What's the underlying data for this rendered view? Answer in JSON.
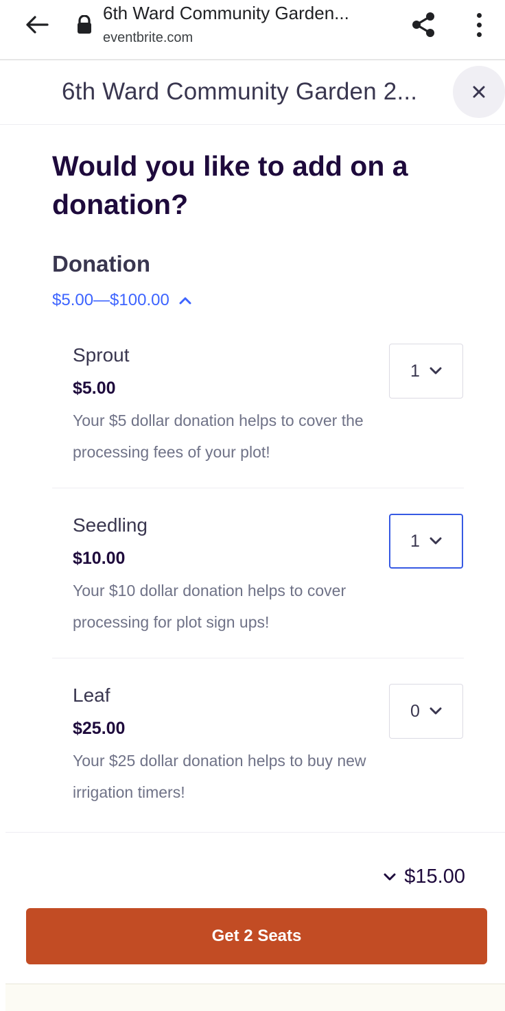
{
  "browser": {
    "page_title": "6th Ward Community Garden...",
    "domain": "eventbrite.com",
    "icons": [
      "back-arrow-icon",
      "lock-icon",
      "share-icon",
      "more-vert-icon"
    ]
  },
  "modal": {
    "title": "6th Ward Community Garden 2...",
    "close_icon": "close-icon"
  },
  "question": "Would you like to add on a donation?",
  "section": {
    "title": "Donation",
    "price_range": "$5.00—$100.00",
    "toggle_icon": "chevron-up-icon"
  },
  "tickets": [
    {
      "name": "Sprout",
      "price": "$5.00",
      "description": "Your $5 dollar donation helps to cover the processing fees of your plot!",
      "quantity": "1"
    },
    {
      "name": "Seedling",
      "price": "$10.00",
      "description": "Your $10 dollar donation helps to cover processing for plot sign ups!",
      "quantity": "1"
    },
    {
      "name": "Leaf",
      "price": "$25.00",
      "description": "Your $25 dollar donation helps to buy new irrigation timers!",
      "quantity": "0"
    }
  ],
  "footer": {
    "total": "$15.00",
    "checkout_label": "Get 2 Seats"
  },
  "colors": {
    "accent_blue": "#3d64ff",
    "checkout_orange": "#c24c24",
    "heading": "#1e0a3c"
  }
}
